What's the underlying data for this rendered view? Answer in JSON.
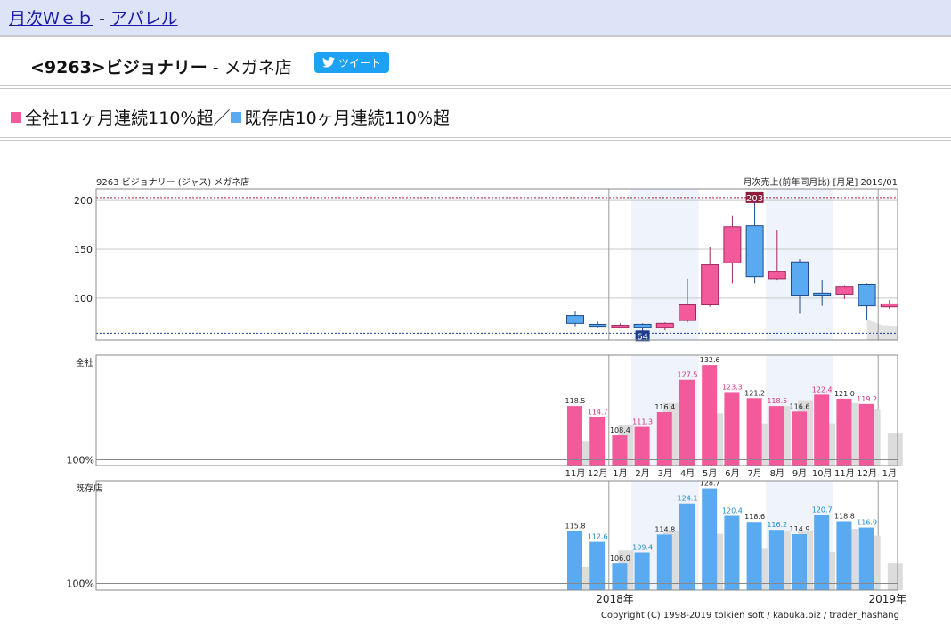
{
  "breadcrumb": {
    "home": "月次Ｗｅｂ",
    "sep": "-",
    "category": "アパレル"
  },
  "title": {
    "code": "<9263>",
    "name": "ビジョナリー",
    "sep": "-",
    "sub": "メガネ店"
  },
  "tweet": {
    "label": "ツイート"
  },
  "headline": {
    "part1": "全社11ヶ月連続110%超／",
    "part2": "既存店10ヶ月連続110%超"
  },
  "colors": {
    "pink": "#f25a9c",
    "blue": "#5aaaf2",
    "shade": "#eef3fc"
  },
  "chart_data": {
    "type": "bar",
    "title_left": "9263 ビジョナリー (ジャス) メガネ店",
    "title_right": "月次売上(前年同月比) [月足] 2019/01",
    "months": [
      "11月",
      "12月",
      "1月",
      "2月",
      "3月",
      "4月",
      "5月",
      "6月",
      "7月",
      "8月",
      "9月",
      "10月",
      "11月",
      "12月",
      "1月"
    ],
    "year_labels": [
      {
        "index": 2,
        "label": "2018年"
      },
      {
        "index": 14,
        "label": "2019年"
      }
    ],
    "copyright": "Copyright (C) 1998-2019 tolkien soft / kabuka.biz / trader_hashang",
    "shaded_groups": [
      [
        3,
        5
      ],
      [
        9,
        11
      ]
    ],
    "candle": {
      "y_ticks": [
        100,
        150,
        200
      ],
      "ylim": [
        57,
        212
      ],
      "max_line": 203,
      "min_line": 64,
      "max_label": "203",
      "min_label": "64",
      "candles": [
        {
          "index": 0,
          "open": 82,
          "close": 74,
          "high": 87,
          "low": 71,
          "color": "blue"
        },
        {
          "index": 1,
          "open": 73,
          "close": 71,
          "high": 76,
          "low": 70,
          "color": "blue"
        },
        {
          "index": 2,
          "open": 70,
          "close": 72,
          "high": 74,
          "low": 69,
          "color": "pink"
        },
        {
          "index": 3,
          "open": 73,
          "close": 70,
          "high": 74,
          "low": 64,
          "color": "blue"
        },
        {
          "index": 4,
          "open": 70,
          "close": 74,
          "high": 75,
          "low": 67,
          "color": "pink"
        },
        {
          "index": 5,
          "open": 77,
          "close": 93,
          "high": 120,
          "low": 75,
          "color": "pink"
        },
        {
          "index": 6,
          "open": 93,
          "close": 134,
          "high": 152,
          "low": 91,
          "color": "pink"
        },
        {
          "index": 7,
          "open": 136,
          "close": 173,
          "high": 184,
          "low": 115,
          "color": "pink"
        },
        {
          "index": 8,
          "open": 174,
          "close": 122,
          "high": 203,
          "low": 115,
          "color": "blue"
        },
        {
          "index": 9,
          "open": 120,
          "close": 127,
          "high": 170,
          "low": 118,
          "color": "pink"
        },
        {
          "index": 10,
          "open": 137,
          "close": 103,
          "high": 140,
          "low": 84,
          "color": "blue"
        },
        {
          "index": 11,
          "open": 105,
          "close": 103,
          "high": 119,
          "low": 92,
          "color": "blue"
        },
        {
          "index": 12,
          "open": 104,
          "close": 112,
          "high": 113,
          "low": 99,
          "color": "pink"
        },
        {
          "index": 13,
          "open": 114,
          "close": 92,
          "high": 115,
          "low": 77,
          "color": "blue"
        },
        {
          "index": 14,
          "open": 91,
          "close": 94,
          "high": 98,
          "low": 89,
          "color": "pink"
        }
      ],
      "grey_area": [
        [
          13,
          78
        ],
        [
          13.7,
          72
        ],
        [
          14.6,
          71
        ]
      ]
    },
    "series": [
      {
        "name": "全社",
        "ylim": [
          98,
          136
        ],
        "baseline": 100,
        "baseline_label": "100%",
        "values": [
          118.5,
          114.7,
          108.4,
          111.3,
          116.4,
          127.5,
          132.6,
          123.3,
          121.2,
          118.5,
          116.6,
          122.4,
          121.0,
          119.2,
          null
        ],
        "labels": [
          "118.5",
          "114.7",
          "108.4",
          "111.3",
          "116.4",
          "127.5",
          "132.6",
          "123.3",
          "121.2",
          "118.5",
          "116.6",
          "122.4",
          "121.0",
          "119.2",
          ""
        ],
        "label_colors": [
          "dark",
          "pink",
          "dark",
          "pink",
          "dark",
          "pink",
          "dark",
          "pink",
          "dark",
          "pink",
          "dark",
          "pink",
          "dark",
          "pink",
          "dark"
        ],
        "prev_year": [
          106.5,
          null,
          112,
          null,
          119.5,
          null,
          116,
          null,
          112.5,
          118.5,
          120.5,
          112.5,
          119.5,
          117.5,
          109
        ]
      },
      {
        "name": "既存店",
        "ylim": [
          98,
          131
        ],
        "baseline": 100,
        "baseline_label": "100%",
        "values": [
          115.8,
          112.6,
          106.0,
          109.4,
          114.8,
          124.1,
          128.7,
          120.4,
          118.6,
          116.2,
          114.9,
          120.7,
          118.8,
          116.9,
          null
        ],
        "labels": [
          "115.8",
          "112.6",
          "106.0",
          "109.4",
          "114.8",
          "124.1",
          "128.7",
          "120.4",
          "118.6",
          "116.2",
          "114.9",
          "120.7",
          "118.8",
          "116.9",
          ""
        ],
        "label_colors": [
          "dark",
          "blue",
          "dark",
          "blue",
          "dark",
          "blue",
          "dark",
          "blue",
          "dark",
          "blue",
          "dark",
          "blue",
          "dark",
          "blue",
          "dark"
        ],
        "prev_year": [
          105,
          null,
          110,
          null,
          116,
          null,
          115,
          null,
          110.5,
          116,
          116,
          109.5,
          116.5,
          114.5,
          106
        ]
      }
    ]
  }
}
